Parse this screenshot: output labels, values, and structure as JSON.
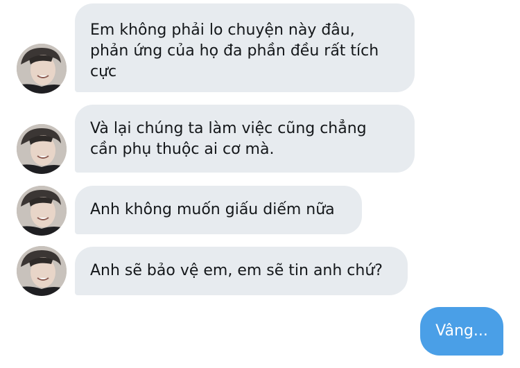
{
  "conversation": {
    "messages": [
      {
        "sender": "other",
        "text": "Em không phải lo chuyện này đâu,\nphản ứng của họ đa phần đều rất tích\ncực"
      },
      {
        "sender": "other",
        "text": "Và lại chúng ta làm việc cũng chẳng\ncần phụ thuộc ai cơ mà."
      },
      {
        "sender": "other",
        "text": "Anh không muốn giấu diếm nữa"
      },
      {
        "sender": "other",
        "text": "Anh sẽ bảo vệ em, em sẽ tin anh chứ?"
      },
      {
        "sender": "me",
        "text": "Vâng..."
      }
    ]
  },
  "colors": {
    "incoming_bubble": "#e7ebef",
    "outgoing_bubble": "#4a9fe7",
    "incoming_text": "#14171a",
    "outgoing_text": "#ffffff"
  }
}
